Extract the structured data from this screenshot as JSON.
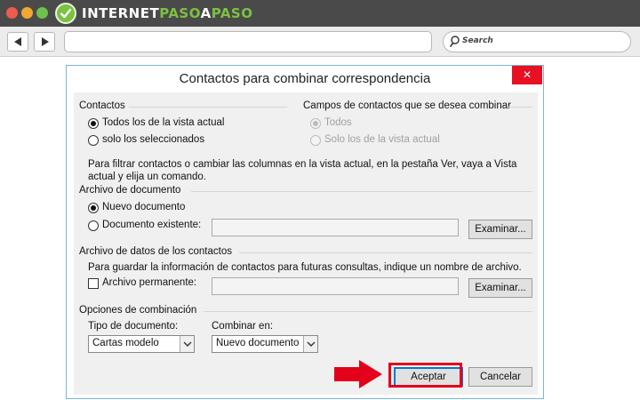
{
  "browser": {
    "brand_text_1": "INTERNET",
    "brand_text_2": "PASO",
    "brand_text_3": "A",
    "brand_text_4": "PASO",
    "search_placeholder": "Search",
    "brand_color": "#7cc142"
  },
  "dialog": {
    "title": "Contactos para combinar correspondencia",
    "close_label": "✕",
    "contacts": {
      "label": "Contactos",
      "option_all": "Todos los de la vista actual",
      "option_selected": "solo los seleccionados"
    },
    "fields": {
      "label": "Campos de contactos que se desea combinar",
      "option_all": "Todos",
      "option_view": "Solo los de la vista actual"
    },
    "filter_note_line1": "Para filtrar contactos o cambiar las columnas en la vista actual, en la pestaña Ver, vaya a Vista",
    "filter_note_line2": "actual y elija un comando.",
    "document_file": {
      "label": "Archivo de documento",
      "option_new": "Nuevo documento",
      "option_existing": "Documento existente:",
      "browse_label": "Examinar..."
    },
    "contact_data_file": {
      "label": "Archivo de datos de los contactos",
      "note": "Para guardar la información de contactos para futuras consultas, indique un nombre de archivo.",
      "permanent_label": "Archivo permanente:",
      "browse_label": "Examinar..."
    },
    "merge_options": {
      "label": "Opciones de combinación",
      "doc_type_label": "Tipo de documento:",
      "doc_type_value": "Cartas modelo",
      "merge_to_label": "Combinar en:",
      "merge_to_value": "Nuevo documento"
    },
    "ok_label": "Aceptar",
    "cancel_label": "Cancelar",
    "highlight_color": "#e3001b"
  }
}
